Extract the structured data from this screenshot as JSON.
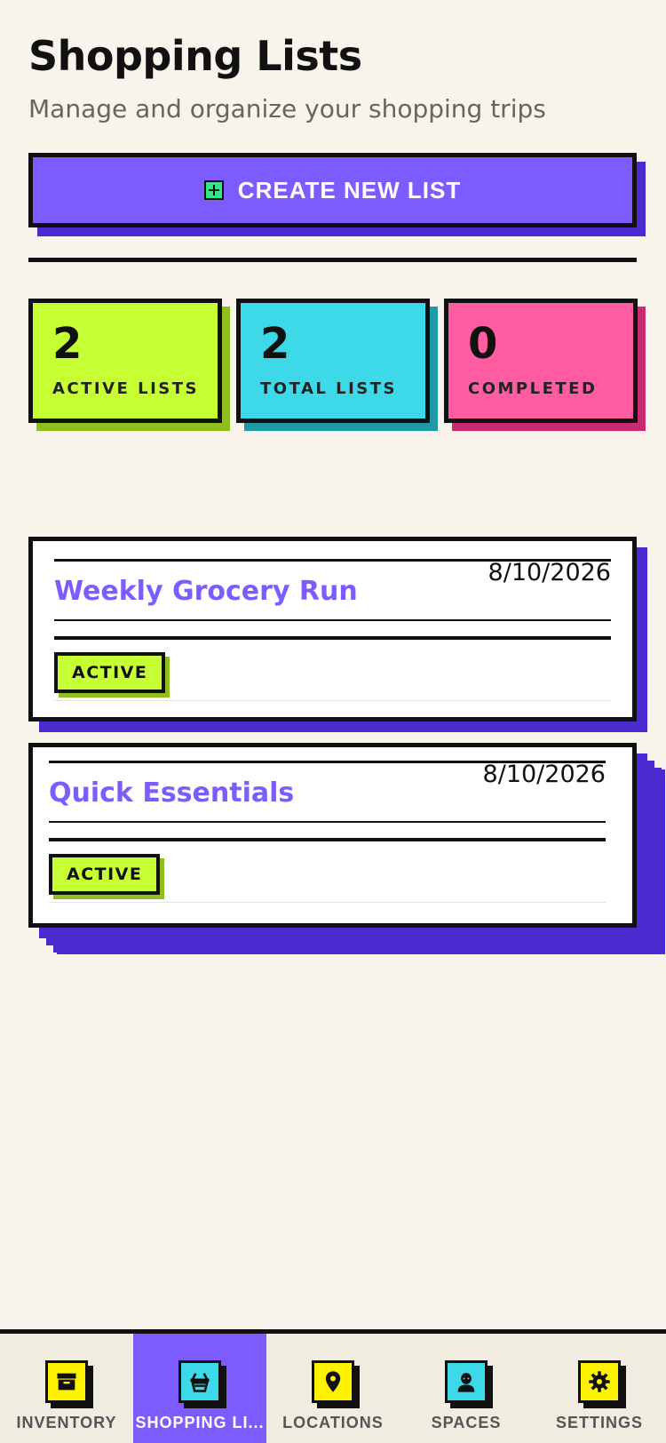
{
  "header": {
    "title": "Shopping Lists",
    "subtitle": "Manage and organize your shopping trips"
  },
  "create_button": {
    "label": "CREATE NEW LIST",
    "icon": "plus-square-icon"
  },
  "stats": [
    {
      "value": "2",
      "label": "ACTIVE LISTS",
      "color": "#c6ff33"
    },
    {
      "value": "2",
      "label": "TOTAL LISTS",
      "color": "#3dd9e8"
    },
    {
      "value": "0",
      "label": "COMPLETED",
      "color": "#ff5ca2"
    }
  ],
  "lists": [
    {
      "name": "Weekly Grocery Run",
      "date": "8/10/2026",
      "status": "ACTIVE"
    },
    {
      "name": "Quick Essentials",
      "date": "8/10/2026",
      "status": "ACTIVE"
    }
  ],
  "tabbar": {
    "active": "shopping",
    "tabs": [
      {
        "label": "INVENTORY",
        "icon": "archive-box-icon"
      },
      {
        "label": "SHOPPING LI...",
        "icon": "basket-icon"
      },
      {
        "label": "LOCATIONS",
        "icon": "map-pin-icon"
      },
      {
        "label": "SPACES",
        "icon": "person-icon"
      },
      {
        "label": "SETTINGS",
        "icon": "gear-icon"
      }
    ]
  },
  "colors": {
    "accent": "#7c5cff",
    "accent_shadow": "#4a2bcf",
    "background": "#f8f4ec"
  }
}
